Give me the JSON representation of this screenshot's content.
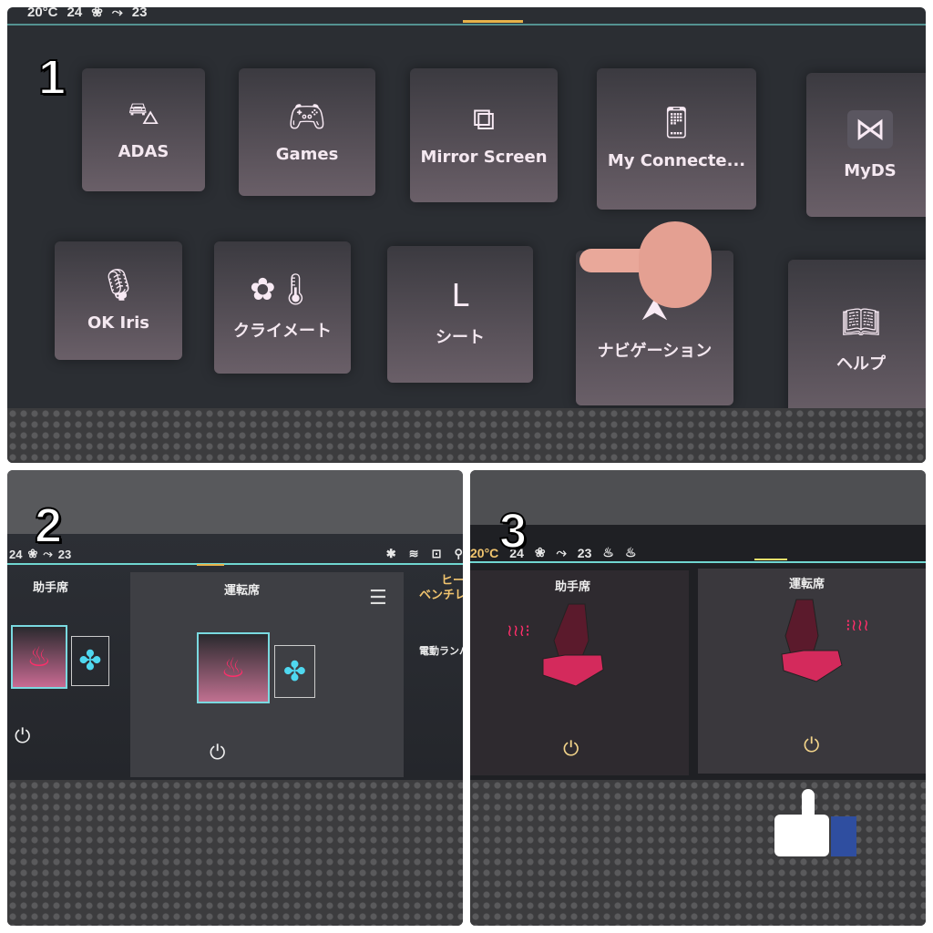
{
  "panel1": {
    "number": "1",
    "status": {
      "temp": "20°C",
      "left_temp": "24",
      "right_temp": "23"
    },
    "apps": [
      {
        "label": "ADAS",
        "icon": "car-icon"
      },
      {
        "label": "Games",
        "icon": "gamepad-icon"
      },
      {
        "label": "Mirror Screen",
        "icon": "mirror-screen-icon"
      },
      {
        "label": "My Connecte...",
        "icon": "phone-signal-icon"
      },
      {
        "label": "MyDS",
        "icon": "ds-logo-icon"
      },
      {
        "label": "OK Iris",
        "icon": "microphone-icon"
      },
      {
        "label": "クライメート",
        "icon": "fan-thermometer-icon"
      },
      {
        "label": "シート",
        "icon": "seat-icon"
      },
      {
        "label": "ナビゲーション",
        "icon": "navigation-arrow-icon"
      },
      {
        "label": "ヘルプ",
        "icon": "book-info-icon"
      }
    ]
  },
  "panel2": {
    "number": "2",
    "status": {
      "left_temp": "24",
      "right_temp": "23"
    },
    "passenger_label": "助手席",
    "driver_label": "運転席",
    "side_items": [
      "ヒー",
      "ベンチレ",
      "電動ランバ"
    ]
  },
  "panel3": {
    "number": "3",
    "status": {
      "temp": "20°C",
      "left_temp": "24",
      "right_temp": "23"
    },
    "passenger_label": "助手席",
    "driver_label": "運転席"
  },
  "colors": {
    "heat": "#ff2e6a",
    "vent": "#4fd8f0",
    "accent_line": "#6fd6d0",
    "power": "#f3d48a"
  }
}
